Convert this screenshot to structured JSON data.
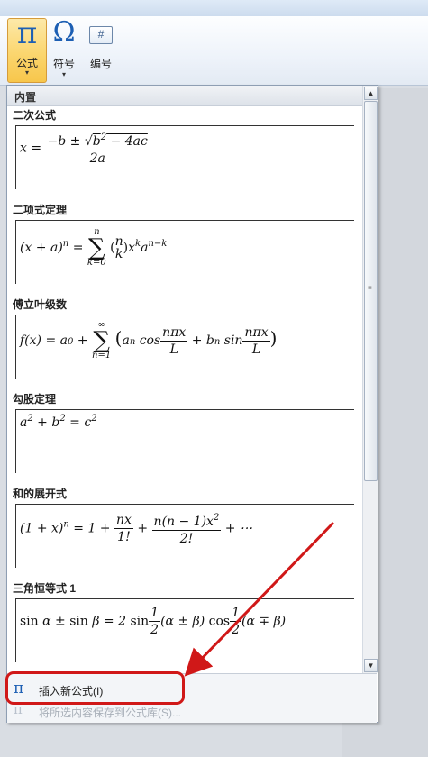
{
  "ribbon": {
    "formula": {
      "icon": "pi-icon",
      "glyph": "π",
      "label": "公式",
      "caret": "▾"
    },
    "symbol": {
      "icon": "omega-icon",
      "glyph": "Ω",
      "label": "符号",
      "caret": "▾"
    },
    "number": {
      "icon": "number-icon",
      "glyph": "#",
      "label": "编号"
    }
  },
  "gallery": {
    "header": "内置",
    "items": [
      {
        "title": "二次公式"
      },
      {
        "title": "二项式定理"
      },
      {
        "title": "傅立叶级数"
      },
      {
        "title": "勾股定理"
      },
      {
        "title": "和的展开式"
      },
      {
        "title": "三角恒等式 1"
      }
    ],
    "footer": {
      "insert_new": "插入新公式(I)",
      "save_selection": "将所选内容保存到公式库(S)..."
    }
  },
  "colors": {
    "accent": "#1d5fb3",
    "highlight": "#d01818"
  }
}
